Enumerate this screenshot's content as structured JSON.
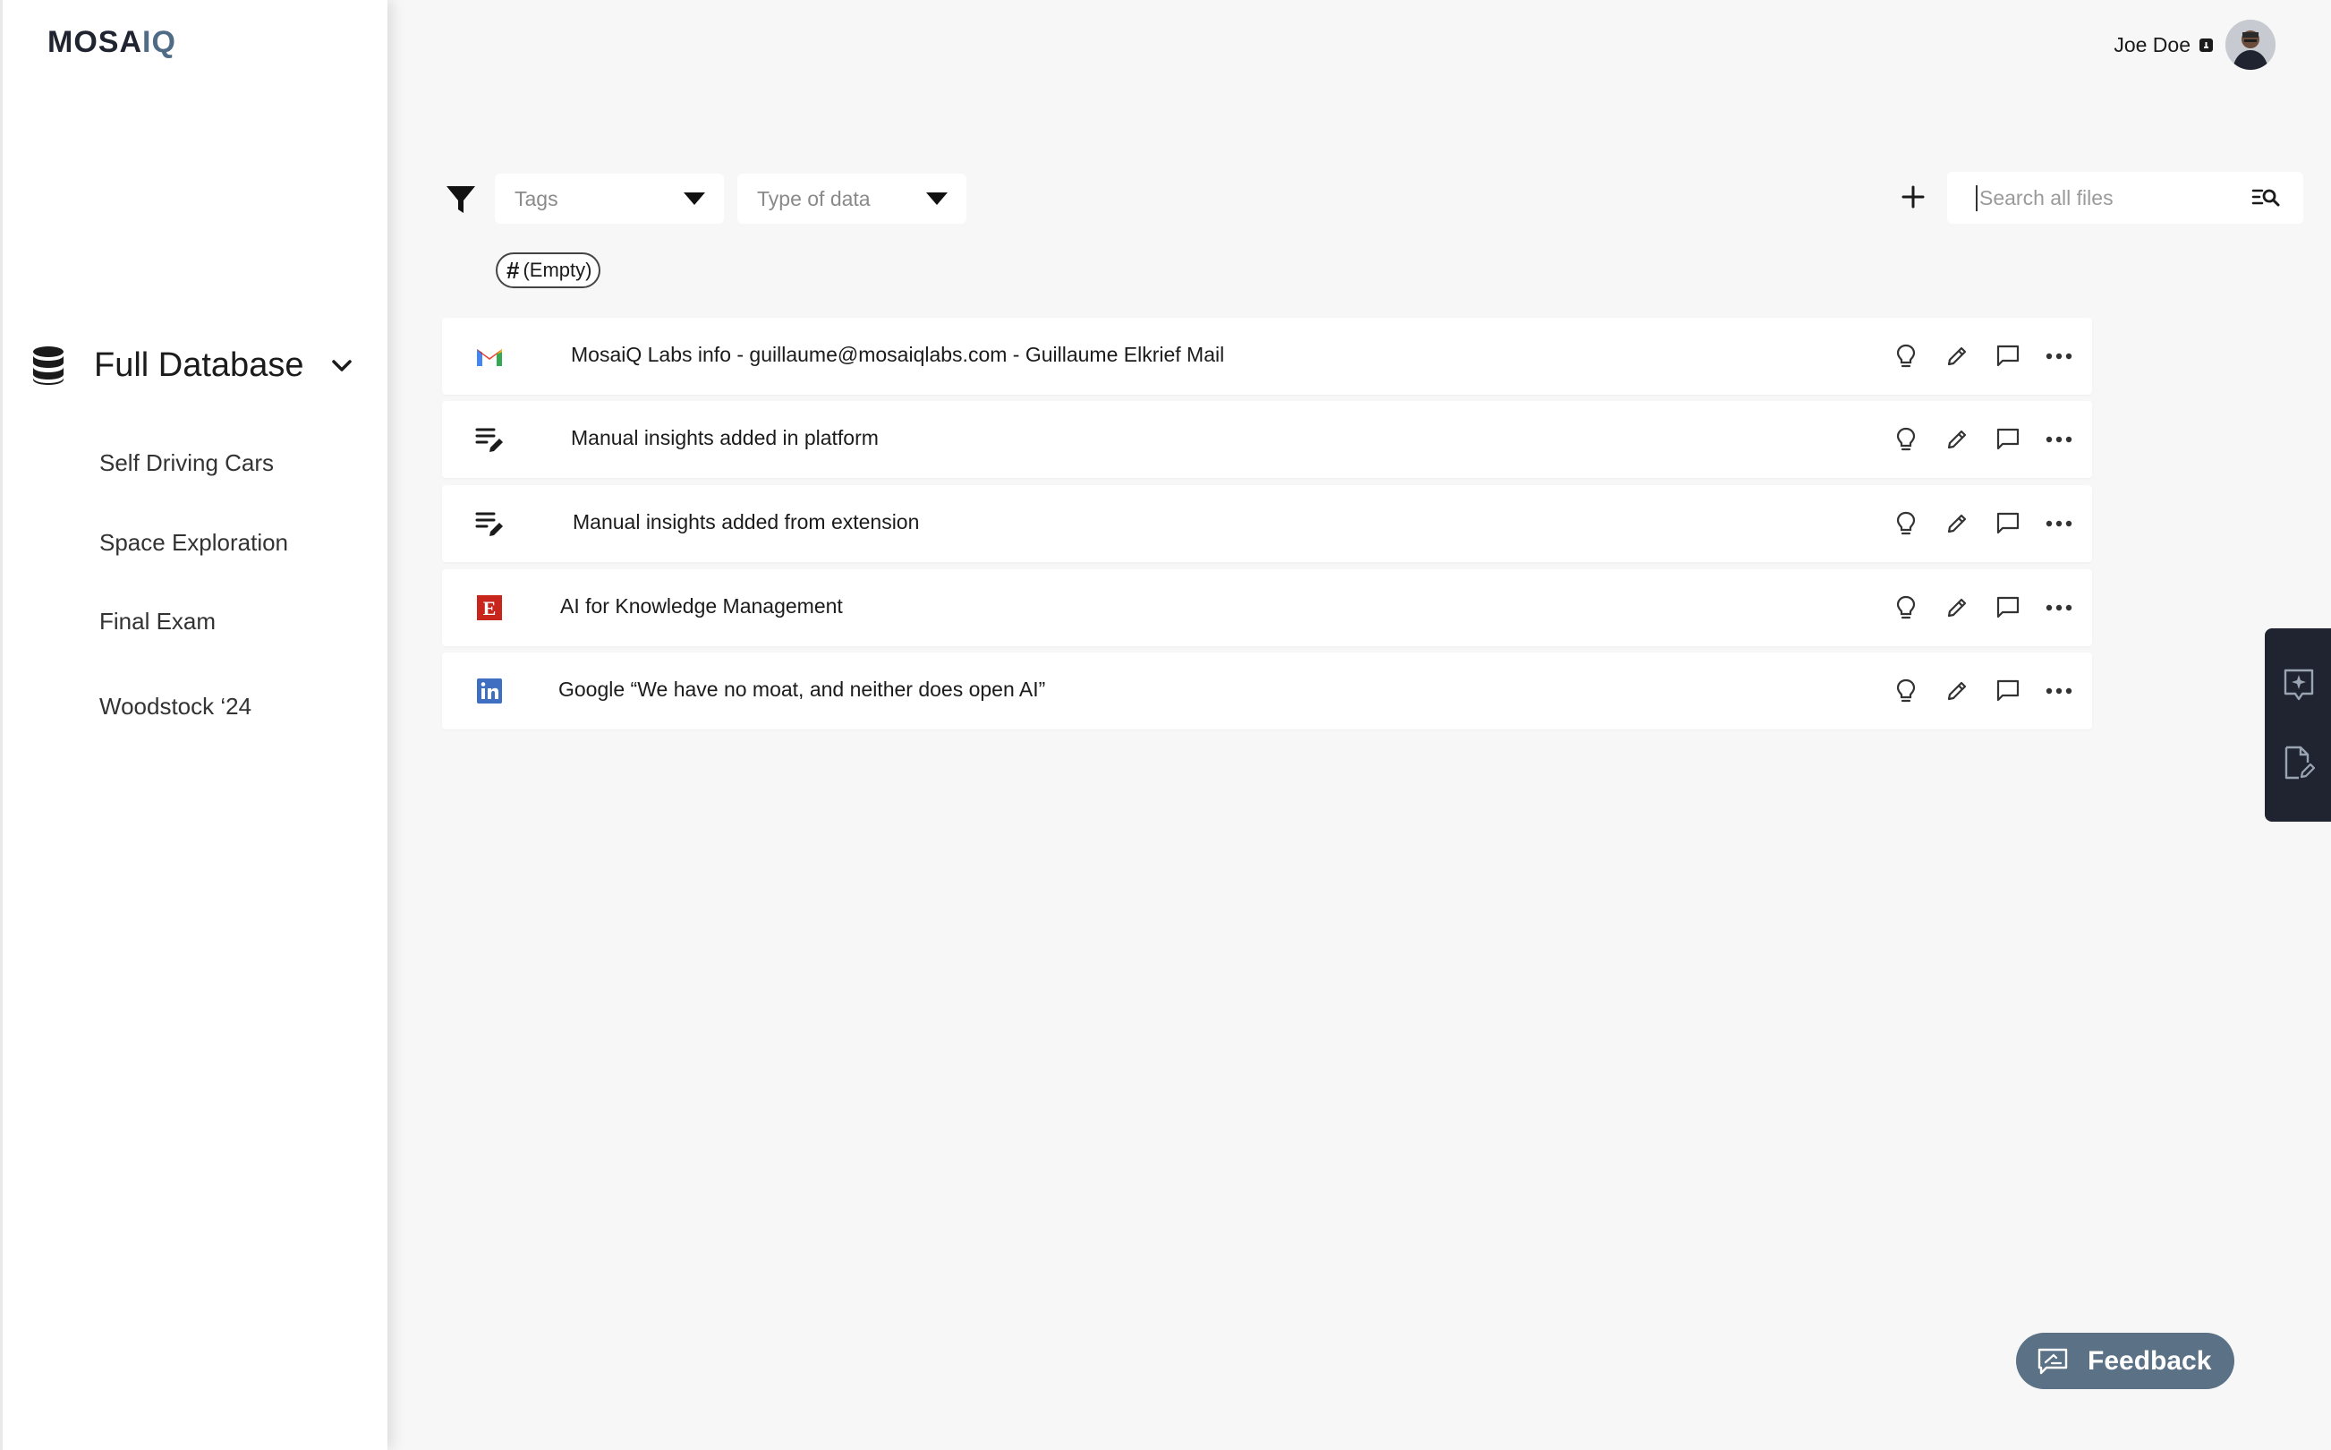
{
  "app": {
    "logo_left": "MOSA",
    "logo_right": "IQ"
  },
  "user": {
    "name": "Joe Doe"
  },
  "sidebar": {
    "database_title": "Full Database",
    "items": [
      {
        "label": "Self Driving Cars"
      },
      {
        "label": "Space Exploration"
      },
      {
        "label": "Final Exam"
      },
      {
        "label": "Woodstock ‘24"
      }
    ]
  },
  "filters": {
    "tags_placeholder": "Tags",
    "type_placeholder": "Type of data",
    "active_tag": "(Empty)"
  },
  "search": {
    "placeholder": "Search all files",
    "value": ""
  },
  "files": [
    {
      "source": "gmail-icon",
      "title": "MosaiQ Labs info - guillaume@mosaiqlabs.com - Guillaume Elkrief Mail"
    },
    {
      "source": "manual-note-icon",
      "title": "Manual insights added in platform"
    },
    {
      "source": "manual-note-icon",
      "title": "Manual insights added from extension"
    },
    {
      "source": "economist-icon",
      "title": "AI for Knowledge Management"
    },
    {
      "source": "linkedin-icon",
      "title": "Google  “We have no moat, and neither does open AI”"
    }
  ],
  "feedback": {
    "label": "Feedback"
  },
  "colors": {
    "accent": "#5b7186",
    "panel": "#1f2430",
    "background": "#f7f7f7"
  }
}
